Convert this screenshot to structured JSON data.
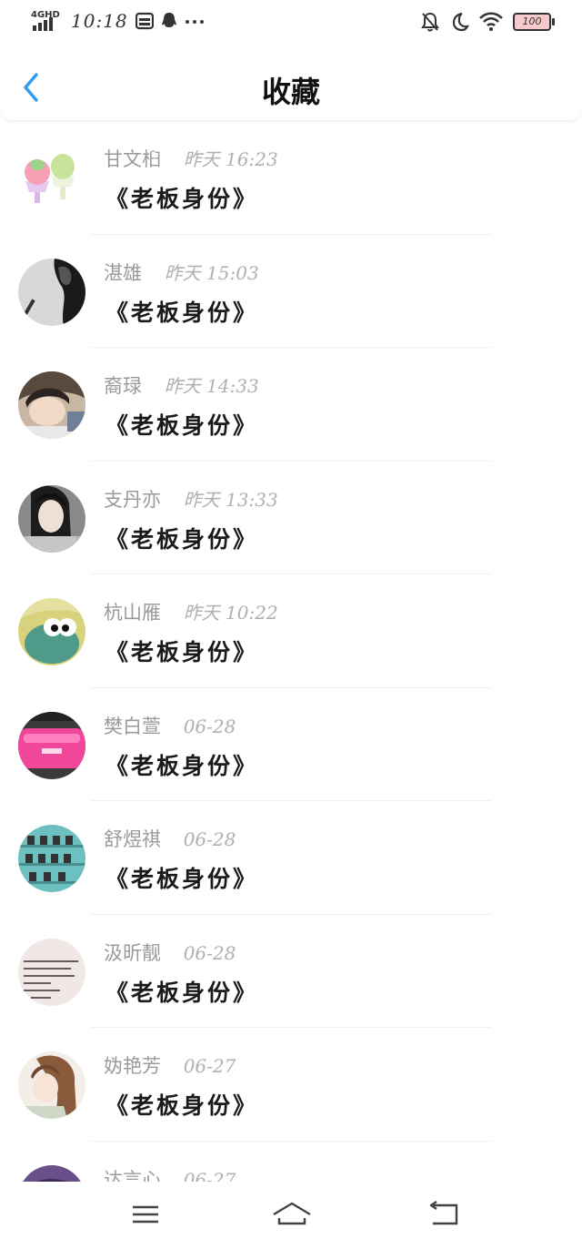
{
  "status_bar": {
    "network": "4GHD",
    "time": "10:18",
    "battery": "100"
  },
  "header": {
    "title": "收藏"
  },
  "favorites": [
    {
      "name": "甘文桕",
      "time": "昨天 16:23",
      "title": "《老板身份》"
    },
    {
      "name": "湛雄",
      "time": "昨天 15:03",
      "title": "《老板身份》"
    },
    {
      "name": "裔琭",
      "time": "昨天 14:33",
      "title": "《老板身份》"
    },
    {
      "name": "支丹亦",
      "time": "昨天 13:33",
      "title": "《老板身份》"
    },
    {
      "name": "杭山雁",
      "time": "昨天 10:22",
      "title": "《老板身份》"
    },
    {
      "name": "樊白萱",
      "time": "06-28",
      "title": "《老板身份》"
    },
    {
      "name": "舒煜祺",
      "time": "06-28",
      "title": "《老板身份》"
    },
    {
      "name": "汲昕靓",
      "time": "06-28",
      "title": "《老板身份》"
    },
    {
      "name": "妫艳芳",
      "time": "06-27",
      "title": "《老板身份》"
    },
    {
      "name": "达言心",
      "time": "06-27",
      "title": ""
    }
  ],
  "colors": {
    "accent": "#2f9bf0",
    "name_text": "#9a9a9a",
    "title_text": "#1a1a1a"
  }
}
